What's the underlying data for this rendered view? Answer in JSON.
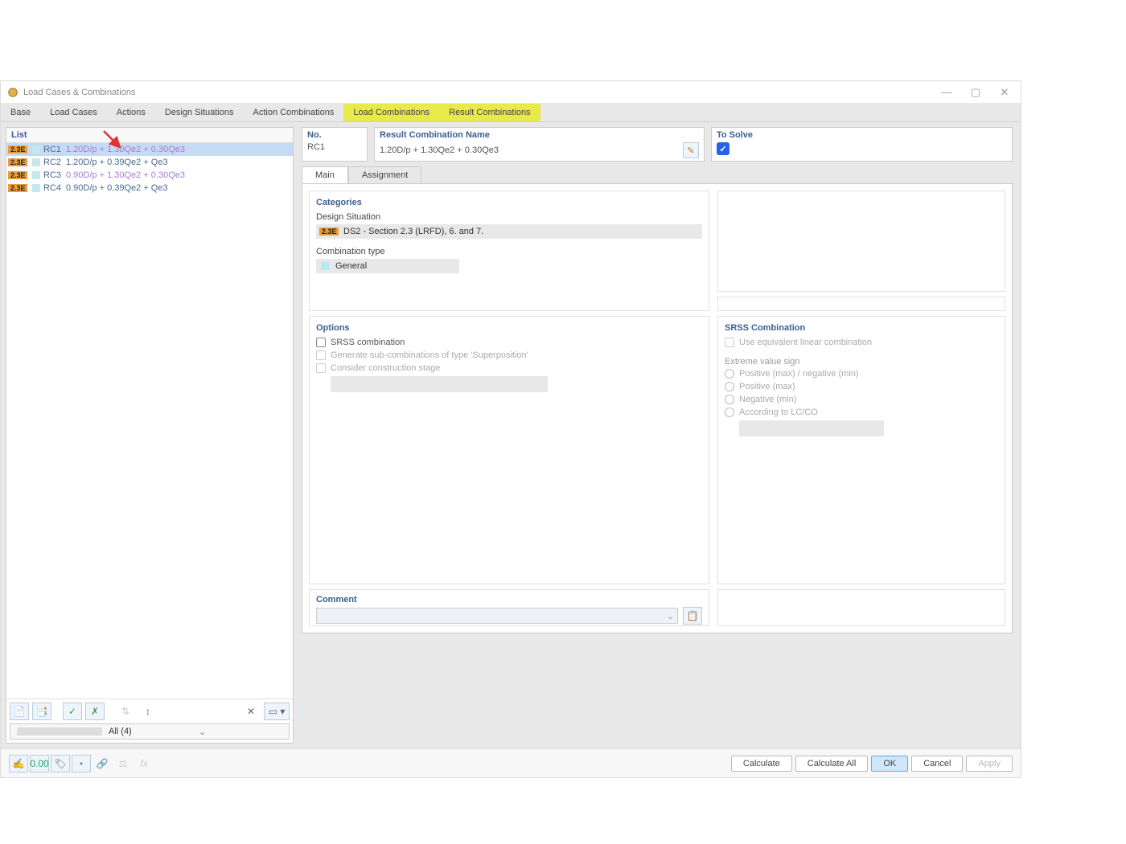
{
  "window": {
    "title": "Load Cases & Combinations"
  },
  "tabs": {
    "items": [
      "Base",
      "Load Cases",
      "Actions",
      "Design Situations",
      "Action Combinations",
      "Load Combinations",
      "Result Combinations"
    ]
  },
  "list": {
    "header": "List",
    "rows": [
      {
        "badge": "2.3E",
        "id": "RC1",
        "desc": "1.20D/p + 1.30Qe2 + 0.30Qe3",
        "selected": true
      },
      {
        "badge": "2.3E",
        "id": "RC2",
        "desc": "1.20D/p + 0.39Qe2 + Qe3"
      },
      {
        "badge": "2.3E",
        "id": "RC3",
        "desc": "0.90D/p + 1.30Qe2 + 0.30Qe3"
      },
      {
        "badge": "2.3E",
        "id": "RC4",
        "desc": "0.90D/p + 0.39Qe2 + Qe3"
      }
    ],
    "filter": "All (4)"
  },
  "details": {
    "no_label": "No.",
    "no_value": "RC1",
    "name_label": "Result Combination Name",
    "name_value": "1.20D/p + 1.30Qe2 + 0.30Qe3",
    "solve_label": "To Solve",
    "solve_checked": true,
    "subtabs": {
      "main": "Main",
      "assignment": "Assignment"
    },
    "categories": {
      "title": "Categories",
      "design_situation_label": "Design Situation",
      "design_situation_badge": "2.3E",
      "design_situation_value": "DS2 - Section 2.3 (LRFD), 6. and 7.",
      "combination_type_label": "Combination type",
      "combination_type_value": "General"
    },
    "options": {
      "title": "Options",
      "srss": "SRSS combination",
      "gensub": "Generate sub-combinations of type 'Superposition'",
      "construction": "Consider construction stage"
    },
    "srss_panel": {
      "title": "SRSS Combination",
      "equiv": "Use equivalent linear combination",
      "extreme_label": "Extreme value sign",
      "r1": "Positive (max) / negative (min)",
      "r2": "Positive (max)",
      "r3": "Negative (min)",
      "r4": "According to LC/CO"
    },
    "comment_label": "Comment"
  },
  "footer": {
    "calculate": "Calculate",
    "calculate_all": "Calculate All",
    "ok": "OK",
    "cancel": "Cancel",
    "apply": "Apply"
  }
}
